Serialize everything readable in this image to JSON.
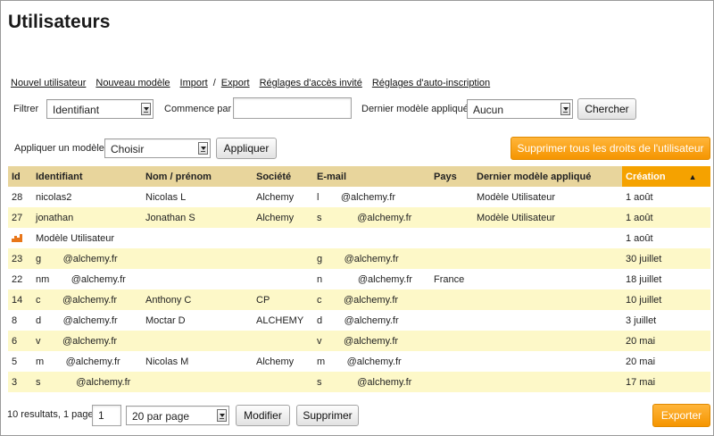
{
  "page": {
    "title": "Utilisateurs"
  },
  "links": {
    "new_user": "Nouvel utilisateur",
    "new_model": "Nouveau modèle",
    "import": "Import",
    "separator": "/",
    "export": "Export",
    "guest_access": "Réglages d'accès invité",
    "self_registration": "Réglages d'auto-inscription"
  },
  "filters": {
    "filter_label": "Filtrer",
    "filter_value": "Identifiant",
    "starts_with_label": "Commence par",
    "starts_with_value": "",
    "last_model_label": "Dernier modèle appliqué",
    "last_model_value": "Aucun",
    "search_button": "Chercher"
  },
  "apply_model": {
    "label": "Appliquer un modèle",
    "select_value": "Choisir",
    "apply_button": "Appliquer",
    "remove_all_rights_button": "Supprimer tous les droits de l'utilisateur"
  },
  "table": {
    "columns": [
      "Id",
      "Identifiant",
      "Nom / prénom",
      "Société",
      "E-mail",
      "Pays",
      "Dernier modèle appliqué",
      "Création"
    ],
    "sort_indicator": "▲",
    "rows": [
      {
        "id": "28",
        "identifiant": "nicolas2",
        "nom": "Nicolas L",
        "societe": "Alchemy",
        "email": "l        @alchemy.fr",
        "pays": "",
        "modele": "Modèle Utilisateur",
        "creation": "1 août"
      },
      {
        "id": "27",
        "identifiant": "jonathan",
        "nom": "Jonathan S",
        "societe": "Alchemy",
        "email": "s             @alchemy.fr",
        "pays": "",
        "modele": "Modèle Utilisateur",
        "creation": "1 août"
      },
      {
        "id": "",
        "identifiant": "Modèle Utilisateur",
        "nom": "",
        "societe": "",
        "email": "",
        "pays": "",
        "modele": "",
        "creation": "1 août",
        "is_model": true
      },
      {
        "id": "23",
        "identifiant": "g        @alchemy.fr",
        "nom": "",
        "societe": "",
        "email": "g        @alchemy.fr",
        "pays": "",
        "modele": "",
        "creation": "30 juillet"
      },
      {
        "id": "22",
        "identifiant": "nm        @alchemy.fr",
        "nom": "",
        "societe": "",
        "email": "n             @alchemy.fr",
        "pays": "France",
        "modele": "",
        "creation": "18 juillet"
      },
      {
        "id": "14",
        "identifiant": "c        @alchemy.fr",
        "nom": "Anthony C",
        "societe": "CP",
        "email": "c        @alchemy.fr",
        "pays": "",
        "modele": "",
        "creation": "10 juillet"
      },
      {
        "id": "8",
        "identifiant": "d        @alchemy.fr",
        "nom": "Moctar D",
        "societe": "ALCHEMY",
        "email": "d        @alchemy.fr",
        "pays": "",
        "modele": "",
        "creation": "3 juillet"
      },
      {
        "id": "6",
        "identifiant": "v        @alchemy.fr",
        "nom": "",
        "societe": "",
        "email": "v        @alchemy.fr",
        "pays": "",
        "modele": "",
        "creation": "20 mai"
      },
      {
        "id": "5",
        "identifiant": "m        @alchemy.fr",
        "nom": "Nicolas M",
        "societe": "Alchemy",
        "email": "m        @alchemy.fr",
        "pays": "",
        "modele": "",
        "creation": "20 mai"
      },
      {
        "id": "3",
        "identifiant": "s             @alchemy.fr",
        "nom": "",
        "societe": "",
        "email": "s             @alchemy.fr",
        "pays": "",
        "modele": "",
        "creation": "17 mai"
      }
    ]
  },
  "footer": {
    "results_text": "10 resultats, 1 pages",
    "page_value": "1",
    "per_page_value": "20 par page",
    "modify_button": "Modifier",
    "delete_button": "Supprimer",
    "export_button": "Exporter"
  },
  "colors": {
    "header_bg": "#e8d59c",
    "sorted_header_bg": "#f5a200",
    "row_alt_bg": "#fdf8c8",
    "orange_button": "#f59500"
  },
  "icons": {
    "model_row_icon": "group-bars-icon",
    "select_arrow": "dropdown-arrow-icon",
    "sort": "sort-ascending-icon"
  }
}
